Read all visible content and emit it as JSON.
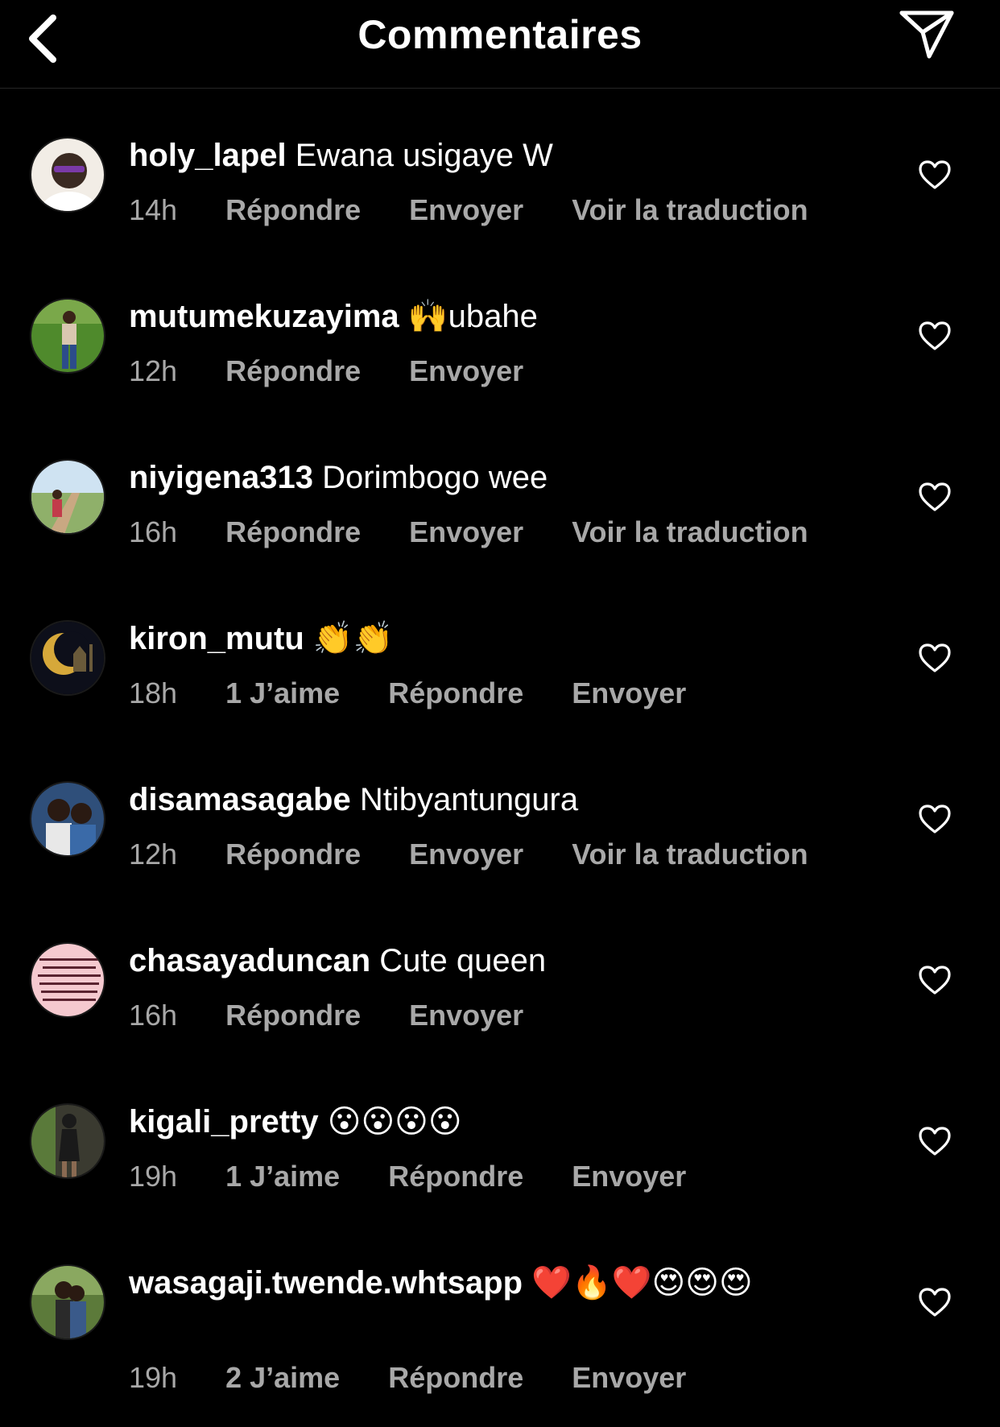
{
  "header": {
    "title": "Commentaires"
  },
  "comments": [
    {
      "username": "holy_lapel",
      "text": "Ewana usigaye W",
      "time": "14h",
      "likes": "",
      "reply": "Répondre",
      "send": "Envoyer",
      "translate": "Voir la traduction"
    },
    {
      "username": "mutumekuzayima",
      "text": "🙌ubahe",
      "time": "12h",
      "likes": "",
      "reply": "Répondre",
      "send": "Envoyer",
      "translate": ""
    },
    {
      "username": "niyigena313",
      "text": "Dorimbogo wee",
      "time": "16h",
      "likes": "",
      "reply": "Répondre",
      "send": "Envoyer",
      "translate": "Voir la traduction"
    },
    {
      "username": "kiron_mutu",
      "text": "👏👏",
      "time": "18h",
      "likes": "1 J’aime",
      "reply": "Répondre",
      "send": "Envoyer",
      "translate": ""
    },
    {
      "username": "disamasagabe",
      "text": "Ntibyantungura",
      "time": "12h",
      "likes": "",
      "reply": "Répondre",
      "send": "Envoyer",
      "translate": "Voir la traduction"
    },
    {
      "username": "chasayaduncan",
      "text": "Cute queen",
      "time": "16h",
      "likes": "",
      "reply": "Répondre",
      "send": "Envoyer",
      "translate": ""
    },
    {
      "username": "kigali_pretty",
      "text": "😮😮😮😮",
      "time": "19h",
      "likes": "1 J’aime",
      "reply": "Répondre",
      "send": "Envoyer",
      "translate": ""
    },
    {
      "username": "wasagaji.twende.whtsapp",
      "text": "❤️🔥❤️😍😍😍",
      "time": "19h",
      "likes": "2 J’aime",
      "reply": "Répondre",
      "send": "Envoyer",
      "translate": ""
    }
  ],
  "avatars": [
    {
      "icon": "avatar-photo-person-white-shirt",
      "bg": "#f2ede6",
      "fg": "#3a2a22"
    },
    {
      "icon": "avatar-photo-person-grass",
      "bg": "#4f8a2c",
      "fg": "#d9c7b0"
    },
    {
      "icon": "avatar-photo-person-field",
      "bg": "#8fb06a",
      "fg": "#c23b4a"
    },
    {
      "icon": "avatar-crescent-moon-mosque",
      "bg": "#0d0f1a",
      "fg": "#d6a83a"
    },
    {
      "icon": "avatar-photo-two-people",
      "bg": "#2f4f7a",
      "fg": "#e8e8e8"
    },
    {
      "icon": "avatar-quote-text-pink",
      "bg": "#f5c9cf",
      "fg": "#5a2330"
    },
    {
      "icon": "avatar-photo-person-dark",
      "bg": "#3a3a30",
      "fg": "#1a1a1a"
    },
    {
      "icon": "avatar-photo-couple-outdoor",
      "bg": "#5c7a3a",
      "fg": "#2a2a2a"
    }
  ],
  "colors": {
    "background": "#000000",
    "text": "#ffffff",
    "secondary": "#a8a8a8",
    "divider": "#262626"
  }
}
